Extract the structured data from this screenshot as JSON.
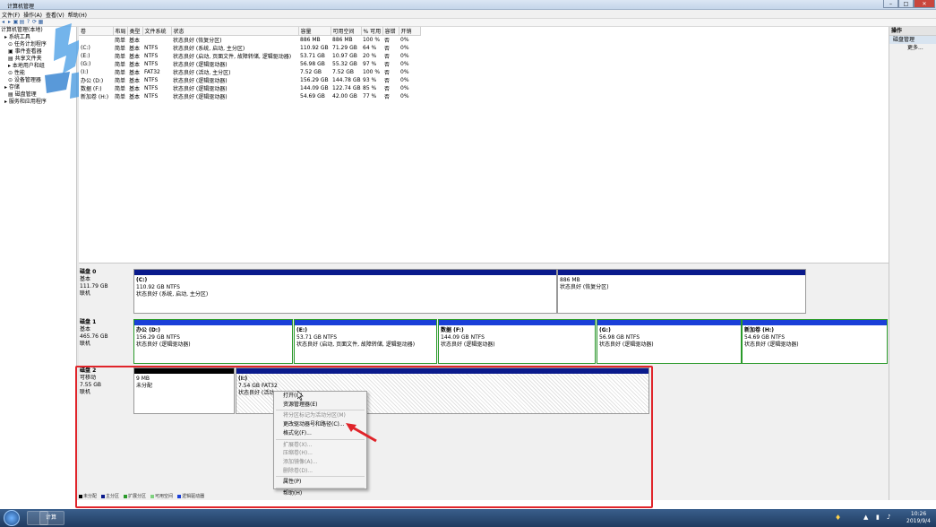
{
  "window": {
    "title": "计算机管理",
    "min_label": "–",
    "max_label": "□",
    "close_label": "✕"
  },
  "menubar": [
    "文件(F)",
    "操作(A)",
    "查看(V)",
    "帮助(H)"
  ],
  "toolbar_icons": [
    "back-arrow-icon",
    "forward-arrow-icon",
    "up-icon",
    "properties-icon",
    "help-icon",
    "refresh-icon",
    "export-icon"
  ],
  "toolbar_glyphs": [
    "◂",
    "▸",
    "▣",
    "▤",
    "?",
    "⟳",
    "▦"
  ],
  "tree": [
    {
      "label": "计算机管理(本地)",
      "indent": 0
    },
    {
      "label": "▸ 系统工具",
      "indent": 1
    },
    {
      "label": "⊙ 任务计划程序",
      "indent": 2
    },
    {
      "label": "▣ 事件查看器",
      "indent": 2
    },
    {
      "label": "▤ 共享文件夹",
      "indent": 2
    },
    {
      "label": "▸ 本地用户和组",
      "indent": 2
    },
    {
      "label": "⊙ 性能",
      "indent": 2
    },
    {
      "label": "⊙ 设备管理器",
      "indent": 2
    },
    {
      "label": "▸ 存储",
      "indent": 1
    },
    {
      "label": "▤ 磁盘管理",
      "indent": 2
    },
    {
      "label": "▸ 服务和应用程序",
      "indent": 1
    }
  ],
  "volume_headers": [
    "卷",
    "布局",
    "类型",
    "文件系统",
    "状态",
    "容量",
    "可用空间",
    "% 可用",
    "容错",
    "开销"
  ],
  "volumes": [
    [
      "",
      "简单",
      "基本",
      "",
      "状态良好 (恢复分区)",
      "886 MB",
      "886 MB",
      "100 %",
      "否",
      "0%"
    ],
    [
      "(C:)",
      "简单",
      "基本",
      "NTFS",
      "状态良好 (系统, 启动, 主分区)",
      "110.92 GB",
      "71.29 GB",
      "64 %",
      "否",
      "0%"
    ],
    [
      "(E:)",
      "简单",
      "基本",
      "NTFS",
      "状态良好 (启动, 页面文件, 故障转储, 逻辑驱动器)",
      "53.71 GB",
      "10.97 GB",
      "20 %",
      "否",
      "0%"
    ],
    [
      "(G:)",
      "简单",
      "基本",
      "NTFS",
      "状态良好 (逻辑驱动器)",
      "56.98 GB",
      "55.32 GB",
      "97 %",
      "否",
      "0%"
    ],
    [
      "(I:)",
      "简单",
      "基本",
      "FAT32",
      "状态良好 (活动, 主分区)",
      "7.52 GB",
      "7.52 GB",
      "100 %",
      "否",
      "0%"
    ],
    [
      "办公 (D:)",
      "简单",
      "基本",
      "NTFS",
      "状态良好 (逻辑驱动器)",
      "156.29 GB",
      "144.78 GB",
      "93 %",
      "否",
      "0%"
    ],
    [
      "数据 (F:)",
      "简单",
      "基本",
      "NTFS",
      "状态良好 (逻辑驱动器)",
      "144.09 GB",
      "122.74 GB",
      "85 %",
      "否",
      "0%"
    ],
    [
      "新加卷 (H:)",
      "简单",
      "基本",
      "NTFS",
      "状态良好 (逻辑驱动器)",
      "54.69 GB",
      "42.00 GB",
      "77 %",
      "否",
      "0%"
    ]
  ],
  "disks": [
    {
      "name": "磁盘 0",
      "type": "基本",
      "size": "111.79 GB",
      "status": "联机",
      "partitions": [
        {
          "label": "(C:)",
          "line2": "110.92 GB NTFS",
          "line3": "状态良好 (系统, 启动, 主分区)",
          "bar": "#0a1a8c"
        },
        {
          "label": "",
          "line2": "886 MB",
          "line3": "状态良好 (恢复分区)",
          "bar": "#0a1a8c"
        }
      ]
    },
    {
      "name": "磁盘 1",
      "type": "基本",
      "size": "465.76 GB",
      "status": "联机",
      "partitions": [
        {
          "label": "办公 (D:)",
          "line2": "156.29 GB NTFS",
          "line3": "状态良好 (逻辑驱动器)",
          "bar": "#1a3fd8"
        },
        {
          "label": "(E:)",
          "line2": "53.71 GB NTFS",
          "line3": "状态良好 (启动, 页面文件, 故障转储, 逻辑驱动器)",
          "bar": "#1a3fd8"
        },
        {
          "label": "数据 (F:)",
          "line2": "144.09 GB NTFS",
          "line3": "状态良好 (逻辑驱动器)",
          "bar": "#1a3fd8"
        },
        {
          "label": "(G:)",
          "line2": "56.98 GB NTFS",
          "line3": "状态良好 (逻辑驱动器)",
          "bar": "#1a3fd8"
        },
        {
          "label": "新加卷 (H:)",
          "line2": "54.69 GB NTFS",
          "line3": "状态良好 (逻辑驱动器)",
          "bar": "#1a3fd8"
        }
      ]
    },
    {
      "name": "磁盘 2",
      "type": "可移动",
      "size": "7.55 GB",
      "status": "联机",
      "partitions": [
        {
          "label": "",
          "line2": "9 MB",
          "line3": "未分配",
          "bar": "#000000"
        },
        {
          "label": "(I:)",
          "line2": "7.54 GB FAT32",
          "line3": "状态良好 (活动...",
          "bar": "#0a1a8c"
        }
      ]
    }
  ],
  "context_menu": [
    {
      "label": "打开(O)",
      "enabled": true
    },
    {
      "label": "资源管理器(E)",
      "enabled": true
    },
    {
      "sep": true
    },
    {
      "label": "将分区标记为活动分区(M)",
      "enabled": false
    },
    {
      "label": "更改驱动器号和路径(C)...",
      "enabled": true
    },
    {
      "label": "格式化(F)...",
      "enabled": true
    },
    {
      "sep": true
    },
    {
      "label": "扩展卷(X)...",
      "enabled": false
    },
    {
      "label": "压缩卷(H)...",
      "enabled": false
    },
    {
      "label": "添加镜像(A)...",
      "enabled": false
    },
    {
      "label": "删除卷(D)...",
      "enabled": false
    },
    {
      "sep": true
    },
    {
      "label": "属性(P)",
      "enabled": true
    },
    {
      "sep": true
    },
    {
      "label": "帮助(H)",
      "enabled": true
    }
  ],
  "ops_panel": {
    "title": "操作",
    "section": "磁盘管理",
    "more": "更多..."
  },
  "legend": [
    {
      "label": "未分配",
      "color": "#000000"
    },
    {
      "label": "主分区",
      "color": "#0a1a8c"
    },
    {
      "label": "扩展分区",
      "color": "#2a9a2a"
    },
    {
      "label": "可用空间",
      "color": "#7fd27f"
    },
    {
      "label": "逻辑驱动器",
      "color": "#1a3fd8"
    }
  ],
  "taskbar": {
    "app_label": "计算",
    "time": "10:26",
    "date": "2019/9/4"
  },
  "colors": {
    "highlight": "#e0242a",
    "arrow": "#e0242a"
  }
}
